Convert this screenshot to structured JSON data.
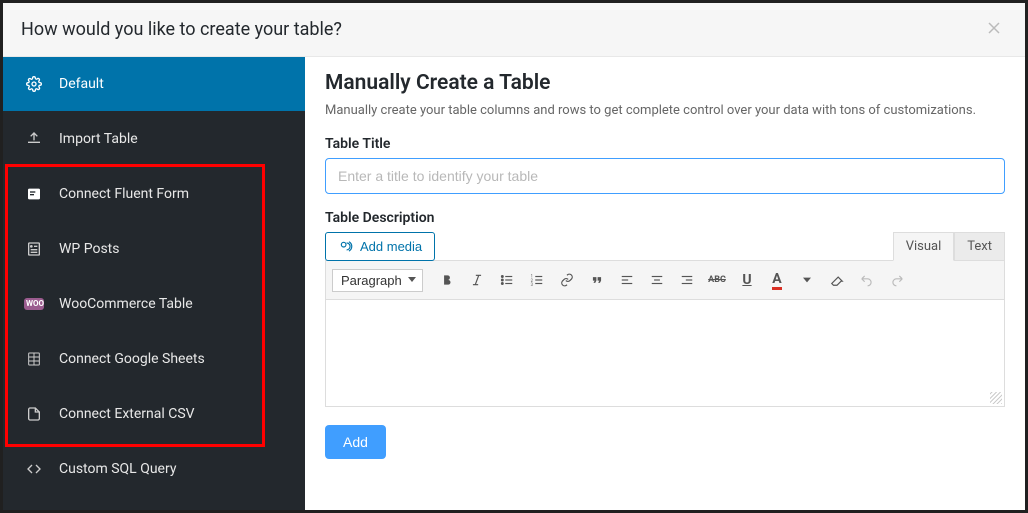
{
  "header": {
    "title": "How would you like to create your table?"
  },
  "sidebar": {
    "items": [
      {
        "label": "Default",
        "icon": "gear-icon"
      },
      {
        "label": "Import Table",
        "icon": "upload-icon"
      },
      {
        "label": "Connect Fluent Form",
        "icon": "form-icon"
      },
      {
        "label": "WP Posts",
        "icon": "posts-icon"
      },
      {
        "label": "WooCommerce Table",
        "icon": "woo-icon"
      },
      {
        "label": "Connect Google Sheets",
        "icon": "sheets-icon"
      },
      {
        "label": "Connect External CSV",
        "icon": "csv-icon"
      },
      {
        "label": "Custom SQL Query",
        "icon": "code-icon"
      }
    ]
  },
  "main": {
    "title": "Manually Create a Table",
    "subtitle": "Manually create your table columns and rows to get complete control over your data with tons of customizations.",
    "title_label": "Table Title",
    "title_placeholder": "Enter a title to identify your table",
    "desc_label": "Table Description",
    "add_media_label": "Add media",
    "visual_tab": "Visual",
    "text_tab": "Text",
    "format_select": "Paragraph",
    "add_btn": "Add"
  }
}
